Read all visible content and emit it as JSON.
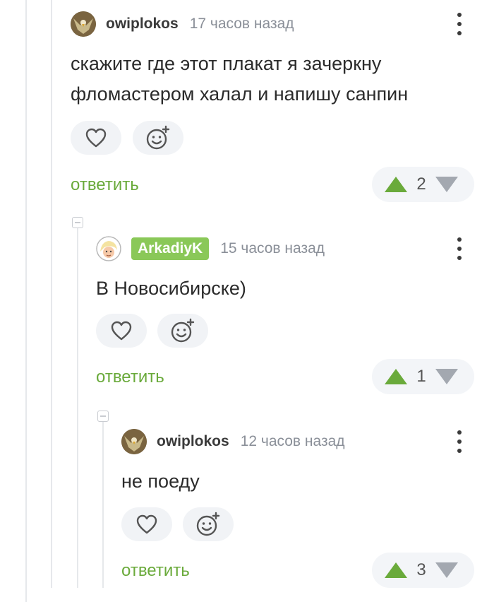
{
  "comments": [
    {
      "author": "owiplokos",
      "time": "17 часов назад",
      "text_lines": [
        "скажите где этот плакат я зачеркну",
        "фломастером халал и напишу санпин"
      ],
      "reply_label": "ответить",
      "rating": "2",
      "avatar_icon": "eagle-avatar"
    },
    {
      "author": "ArkadiyK",
      "time": "15 часов назад",
      "text_lines": [
        "В Новосибирске)"
      ],
      "reply_label": "ответить",
      "rating": "1",
      "avatar_icon": "cartoon-avatar",
      "author_badge_color": "#8ac858"
    },
    {
      "author": "owiplokos",
      "time": "12 часов назад",
      "text_lines": [
        "не поеду"
      ],
      "reply_label": "ответить",
      "rating": "3",
      "avatar_icon": "eagle-avatar"
    }
  ],
  "colors": {
    "accent_green": "#6aaa3b",
    "muted": "#8a8f98",
    "pill_bg": "#f1f3f6"
  }
}
